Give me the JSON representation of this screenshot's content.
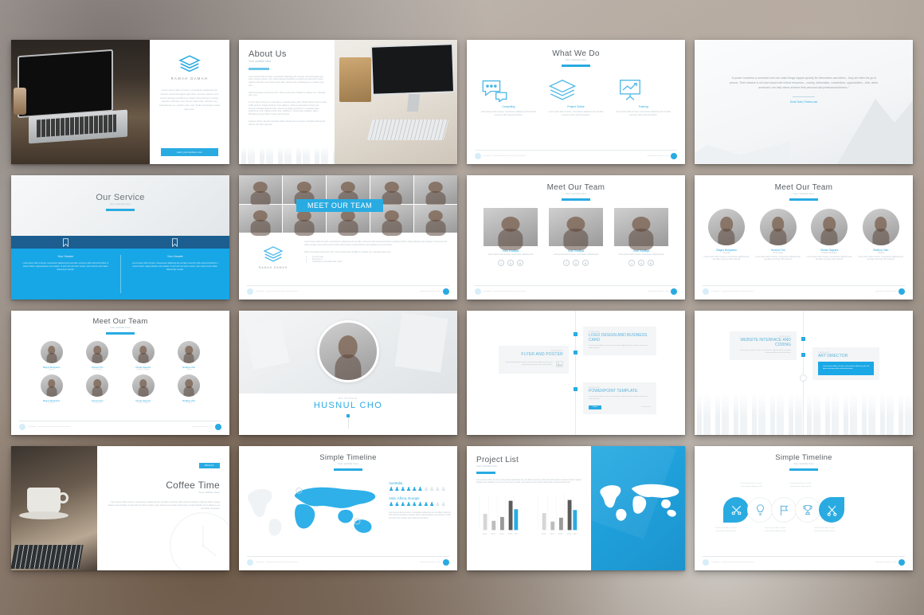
{
  "deck": {
    "brand": "RAMAH DAMAH",
    "footer_left": "Template - professional business presentation",
    "footer_right": "www.yoursitehere.com",
    "accent": "#29abe2",
    "accent_dark": "#1b5e8f",
    "title_color": "#5a5f63",
    "subtitle_default": "Your subtitle here",
    "lorem_short": "Lorem ipsum dolor sit amet, consectetur adipiscing elit, sed do eiusmod tempor incididunt ut labore.",
    "lorem_long": "Lorem ipsum dolor sit amet, consectetur adipiscing elit. Aenean commodo ligula eget dolor. Aenean massa. Cum sociis natoque penatibus et magnis dis parturient montes, nascetur ridiculus mus. Donec quam felis, ultricies nec, pellentesque eu, pretium quis, sem."
  },
  "slides": [
    {
      "id": "cover",
      "brand": "RAMAH DAMAH",
      "body": "Lorem ipsum dolor sit amet, consectetur adipiscing elit. Aenean commodo ligula eget dolor. Aenean massa. Cum sociis natoque penatibus et magnis dis parturient montes, nascetur ridiculus mus. Donec quam felis, ultricies nec, pellentesque eu, pretium quis, sem. Nulla consequat massa quis enim.",
      "button": "www.yoursitehere.com"
    },
    {
      "id": "about-us",
      "title": "About Us",
      "subtitle": "Your subtitle here",
      "p1": "Lorem ipsum dolor sit amet, consectetur adipiscing elit. Aenean commodo ligula eget dolor. Aenean massa. Cum sociis natoque penatibus et magnis dis parturient montes, nascetur ridiculus mus. Donec quam felis, ultricies nec, pellentesque eu, pretium quis, sem.",
      "p2": "Nulla consequat massa quis enim. Donec pede justo, fringilla vel, aliquet nec, vulputate eget, arcu.",
      "p3": "In enim justo, rhoncus ut, imperdiet a, venenatis vitae, justo. Nullam dictum felis eu pede mollis pretium. Integer tincidunt. Cras dapibus. Vivamus elementum semper nisi. Aenean vulputate eleifend tellus. Aenean leo ligula, porttitor eu, consequat vitae, eleifend ac, enim. Aliquam lorem ante, dapibus in, viverra quis, feugiat a, tellus. Phasellus viverra nulla ut metus varius laoreet.",
      "p4": "Quisque rutrum. Aenean imperdiet. Etiam ultricies nisi vel augue. Curabitur ullamcorper ultricies nisi. Nam eget dui."
    },
    {
      "id": "what-we-do",
      "title": "What We Do",
      "subtitle": "Your subtitle here",
      "items": [
        {
          "icon": "chat-bubbles-icon",
          "label": "Consulting",
          "text": "Lorem ipsum dolor sit amet, consectetuer adipiscing elit sed diam nonummy nibh euismod tincidunt."
        },
        {
          "icon": "layers-icon",
          "label": "Project Online",
          "text": "Lorem ipsum dolor sit amet, consectetuer adipiscing elit sed diam nonummy nibh euismod tincidunt."
        },
        {
          "icon": "presentation-chart-icon",
          "label": "Training",
          "text": "Lorem ipsum dolor sit amet, consectetuer adipiscing elit sed diam nonummy nibh euismod tincidunt."
        }
      ]
    },
    {
      "id": "quote",
      "quote": "\"A power connector is someone who can make things happen quickly for themselves and others…they are often the go-to person.  Their network is rich and robust with critical resources – money, information, connections, opportunities – that, when accessed, can help others achieve their personal and professional dreams.\"",
      "author": "Dorie Clark, Forbes.com"
    },
    {
      "id": "our-service",
      "title": "Our Service",
      "subtitle": "Your subtitle here",
      "columns": [
        {
          "icon": "bookmark-icon",
          "header": "Your Header",
          "text": "Lorem ipsum dolor sit amet, consectetuer adipiscing elit sed diam nonummy nibh euismod tincidunt ut laoreet dolore magna aliquam erat volutpat. Ut wisi enim ad minim veniam, quis nostrud exerci tation ullamcorper suscipit."
        },
        {
          "icon": "bookmark-icon",
          "header": "Your Header",
          "text": "Lorem ipsum dolor sit amet, consectetuer adipiscing elit sed diam nonummy nibh euismod tincidunt ut laoreet dolore magna aliquam erat volutpat. Ut wisi enim ad minim veniam, quis nostrud exerci tation ullamcorper suscipit."
        }
      ]
    },
    {
      "id": "meet-our-team-banner",
      "banner": "MEET OUR TEAM",
      "brand": "RAMAH DAMAH",
      "body": "Lorem ipsum dolor sit amet, consectetuer adipiscing elit sed diam nonummy nibh euismod tincidunt ut laoreet dolore magna aliquam erat volutpat. Ut wisi enim ad minim veniam, quis nostrud exerci tation ullamcorper suscipit lobortis nisl ut aliquip ex ea commodo.",
      "intro": "Nulla consequat massa quis enim. Donec pede justo, fringilla vel, aliquet nec, vulputate eget, arcu.",
      "bullets": [
        "In enim justo",
        "Rhoncus ut",
        "Imperdiet a, venenatis vitae, justo"
      ]
    },
    {
      "id": "meet-our-team-3",
      "title": "Meet Our Team",
      "subtitle": "Your subtitle here",
      "members": [
        {
          "name": "Vian Raditya",
          "text": "Lorem ipsum dolor sit amet, consectetuer adipiscing elit",
          "socials": [
            "facebook-icon",
            "google-plus-icon",
            "behance-icon"
          ]
        },
        {
          "name": "Vian Raditya",
          "text": "Lorem ipsum dolor sit amet, consectetuer adipiscing elit",
          "socials": [
            "facebook-icon",
            "google-plus-icon",
            "behance-icon"
          ]
        },
        {
          "name": "Vian Raditya",
          "text": "Lorem ipsum dolor sit amet, consectetuer adipiscing elit",
          "socials": [
            "facebook-icon",
            "google-plus-icon",
            "behance-icon"
          ]
        }
      ]
    },
    {
      "id": "meet-our-team-4",
      "title": "Meet Our Team",
      "subtitle": "Your subtitle here",
      "members": [
        {
          "name": "Bagus Budiyanto",
          "role": "Founder",
          "text": "Lorem ipsum dolor sit amet, consectetuer adipiscing elit, sed diam nonummy nibh euismod."
        },
        {
          "name": "Husnul Cho",
          "role": "Co Founder",
          "text": "Lorem ipsum dolor sit amet, consectetuer adipiscing elit, sed diam nonummy nibh euismod."
        },
        {
          "name": "Dimas Saputra",
          "role": "Creative Designer",
          "text": "Lorem ipsum dolor sit amet, consectetuer adipiscing elit, sed diam nonummy nibh euismod."
        },
        {
          "name": "Radhya Vian",
          "role": "Coding",
          "text": "Lorem ipsum dolor sit amet, consectetuer adipiscing elit, sed diam nonummy nibh euismod."
        }
      ]
    },
    {
      "id": "meet-our-team-8",
      "title": "Meet Our Team",
      "subtitle": "Your subtitle here",
      "members": [
        {
          "name": "Bagus Budiyanto",
          "role": "Founder"
        },
        {
          "name": "Husnul Cho",
          "role": "Co Founder"
        },
        {
          "name": "Dimas Saputra",
          "role": "Creative Designer"
        },
        {
          "name": "Radhya Vian",
          "role": "Coding"
        },
        {
          "name": "Bagus Budiyanto",
          "role": "Founder"
        },
        {
          "name": "Husnul Cho",
          "role": "Co Founder"
        },
        {
          "name": "Dimas Saputra",
          "role": "Creative Designer"
        },
        {
          "name": "Radhya Vian",
          "role": "Coding"
        }
      ]
    },
    {
      "id": "profile",
      "role": "Art Director",
      "name": "HUSNUL CHO"
    },
    {
      "id": "timeline-cards-a",
      "cards": [
        {
          "month": "FEBRUARY",
          "title": "FLYER AND POSTER",
          "text": "Lorem ipsum dolor sit amet, consectetuer adipiscing elit, sed diam nonummy nibh euismod tincidunt.",
          "icon": "image-icon",
          "align": "right",
          "highlight": false
        },
        {
          "month": "FEBRUARY",
          "title": "LOGO DESIGN AND BUSINESS CARD",
          "text": "Lorem ipsum dolor sit amet, consectetuer adipiscing elit sed diam nonummy nibh euismod.",
          "align": "left",
          "highlight": false
        },
        {
          "month": "FEBRUARY",
          "title": "POWERPOINT TEMPLATE",
          "text": "Lorem ipsum dolor sit amet, consectetuer adipiscing elit sed diam nonummy nibh euismod.",
          "align": "left",
          "highlight": false,
          "tag": "Follow",
          "meta": "5 Comments"
        }
      ]
    },
    {
      "id": "timeline-cards-b",
      "cards": [
        {
          "month": "FEBRUARY",
          "title": "WEBSITE INTERFACE AND CODING",
          "text": "Lorem ipsum dolor sit amet, consectetuer adipiscing elit, sed diam nonummy nibh euismod tincidunt.",
          "align": "right",
          "highlight": false
        },
        {
          "month": "FEBRUARY",
          "title": "ART DIRECTOR",
          "text": "Lorem ipsum dolor sit amet, consectetuer adipiscing elit sed diam nonummy nibh euismod tincidunt.",
          "align": "left",
          "highlight": true
        }
      ]
    },
    {
      "id": "coffee-time",
      "badge": "BREAK",
      "title": "Coffee Time",
      "subtitle": "Your subtitle here",
      "text": "Lorem ipsum dolor sit amet, consectetuer adipiscing elit, sed diam nonummy nibh euismod tincidunt ut laoreet dolore magna aliquam erat volutpat. Ut wisi enim ad minim veniam, quis nostrud exerci tation ullamcorper suscipit lobortis nisl ut aliquip ex ea commodo consequat."
    },
    {
      "id": "timeline-map",
      "title": "Simple Timeline",
      "subtitle": "Your subtitle here",
      "stats": [
        {
          "label": "Australia",
          "filled": 6,
          "total": 10
        },
        {
          "label": "Asia, Africa, Europe",
          "filled": 8,
          "total": 10
        }
      ],
      "text": "Lorem ipsum dolor sit amet, consectetuer adipiscing elit, sed diam nonummy nibh euismod tincidunt ut laoreet dolore magna aliquam erat volutpat. Ut wisi enim ad minim veniam, quis nostrud exerci tation."
    },
    {
      "id": "project-list",
      "title": "Project List",
      "subtitle": "Your subtitle here",
      "text": "Lorem ipsum dolor sit amet, consectetuer adipiscing elit, sed diam nonummy nibh euismod tincidunt ut laoreet dolore magna aliquam erat volutpat. Ut wisi enim ad minim veniam, quis nostrud exerci tation ullamcorper suscipit lobortis nisl."
    },
    {
      "id": "timeline-icons",
      "title": "Simple Timeline",
      "subtitle": "Your subtitle here",
      "steps": [
        {
          "icon": "tools-icon",
          "highlight": true,
          "text": "Lorem ipsum dolor sit amet, consectetuer adipiscing elit",
          "position": "below"
        },
        {
          "icon": "lightbulb-icon",
          "highlight": false,
          "text": "Lorem ipsum dolor sit amet, consectetuer adipiscing elit",
          "position": "above"
        },
        {
          "icon": "flag-icon",
          "highlight": false,
          "text": "Lorem ipsum dolor sit amet, consectetuer adipiscing elit",
          "position": "below"
        },
        {
          "icon": "trophy-icon",
          "highlight": false,
          "text": "Lorem ipsum dolor sit amet, consectetuer adipiscing elit",
          "position": "above"
        },
        {
          "icon": "scissors-icon",
          "highlight": true,
          "text": "Lorem ipsum dolor sit amet, consectetuer adipiscing elit",
          "position": "below"
        }
      ]
    }
  ],
  "chart_data": {
    "type": "bar",
    "title": "Project List",
    "categories": [
      "2013",
      "2014",
      "2015",
      "2016",
      "2017"
    ],
    "series": [
      {
        "name": "Chart 1",
        "values": [
          45,
          25,
          38,
          82,
          58
        ]
      },
      {
        "name": "Chart 2",
        "values": [
          48,
          24,
          36,
          84,
          57
        ]
      }
    ],
    "colors": [
      "#d6d6d6",
      "#bdbdbd",
      "#9a9a9a",
      "#5b5b5b",
      "#29abe2"
    ],
    "ylim": [
      0,
      100
    ],
    "xlabel": "",
    "ylabel": "",
    "grid": true,
    "legend": "none"
  }
}
